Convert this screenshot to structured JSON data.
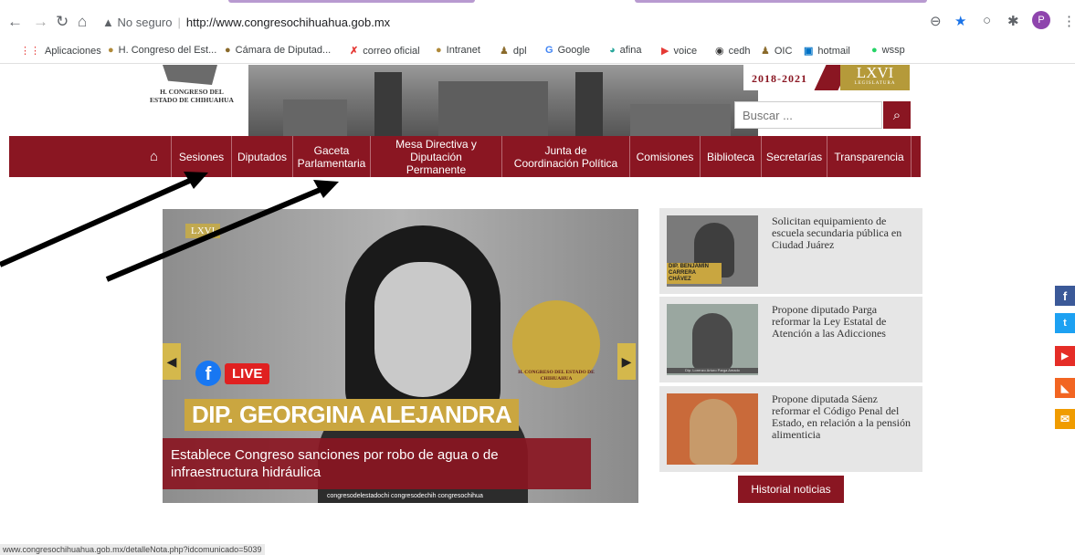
{
  "browser": {
    "security_warning": "No seguro",
    "url": "http://www.congresochihuahua.gob.mx",
    "profile_initial": "P",
    "status_url": "www.congresochihuahua.gob.mx/detalleNota.php?idcomunicado=5039"
  },
  "bookmarks": [
    {
      "label": "Aplicaciones",
      "icon": "apps-grid-icon"
    },
    {
      "label": "H. Congreso del Est...",
      "icon": "seal-icon"
    },
    {
      "label": "Cámara de Diputad...",
      "icon": "seal-icon"
    },
    {
      "label": "correo oficial",
      "icon": "x-mail-icon"
    },
    {
      "label": "Intranet",
      "icon": "seal-icon"
    },
    {
      "label": "dpl",
      "icon": "person-icon"
    },
    {
      "label": "Google",
      "icon": "google-icon"
    },
    {
      "label": "afina",
      "icon": "afina-icon"
    },
    {
      "label": "voice",
      "icon": "youtube-icon"
    },
    {
      "label": "cedh",
      "icon": "globe-icon"
    },
    {
      "label": "OIC",
      "icon": "person-icon"
    },
    {
      "label": "hotmail",
      "icon": "outlook-icon"
    },
    {
      "label": "wssp",
      "icon": "whatsapp-icon"
    }
  ],
  "header": {
    "logo_text": "H. CONGRESO DEL ESTADO DE CHIHUAHUA",
    "years": "2018-2021",
    "legislature_numeral": "LXVI",
    "legislature_word": "LEGISLATURA",
    "search_placeholder": "Buscar ..."
  },
  "nav": {
    "items": [
      {
        "label": "Sesiones"
      },
      {
        "label": "Diputados"
      },
      {
        "label": "Gaceta Parlamentaria"
      },
      {
        "label": "Mesa Directiva y Diputación Permanente"
      },
      {
        "label": "Junta de Coordinación Política"
      },
      {
        "label": "Comisiones"
      },
      {
        "label": "Biblioteca"
      },
      {
        "label": "Secretarías"
      },
      {
        "label": "Transparencia"
      }
    ]
  },
  "slider": {
    "legis_tag": "LXVI",
    "live_label": "LIVE",
    "name_banner": "DIP. GEORGINA ALEJANDRA",
    "seal_text": "H. CONGRESO DEL ESTADO DE CHIHUAHUA",
    "caption": "Establece Congreso sanciones por robo de agua o de infraestructura hidráulica",
    "footer_text": "congresodelestadochi  congresodechih  congresochihua"
  },
  "news": [
    {
      "title": "Solicitan equipamiento de escuela secundaria pública en Ciudad Juárez",
      "thumb_caption": "DIP. BENJAMÍN CARRERA CHÁVEZ"
    },
    {
      "title": "Propone diputado Parga reformar la Ley Estatal de Atención a las Adicciones",
      "thumb_caption": "Dip. Lorenzo Arturo Parga Amado"
    },
    {
      "title": "Propone diputada Sáenz reformar el Código Penal del Estado, en relación a la pensión alimenticia",
      "thumb_caption": ""
    }
  ],
  "history_button": "Historial noticias",
  "social": [
    {
      "name": "facebook-icon",
      "glyph": "f",
      "color": "#3b5998"
    },
    {
      "name": "twitter-icon",
      "glyph": "🐦",
      "color": "#1da1f2"
    },
    {
      "name": "youtube-icon",
      "glyph": "▶",
      "color": "#e52d27"
    },
    {
      "name": "rss-icon",
      "glyph": "◣",
      "color": "#f26522"
    },
    {
      "name": "mail-icon",
      "glyph": "✉",
      "color": "#f09c00"
    }
  ]
}
